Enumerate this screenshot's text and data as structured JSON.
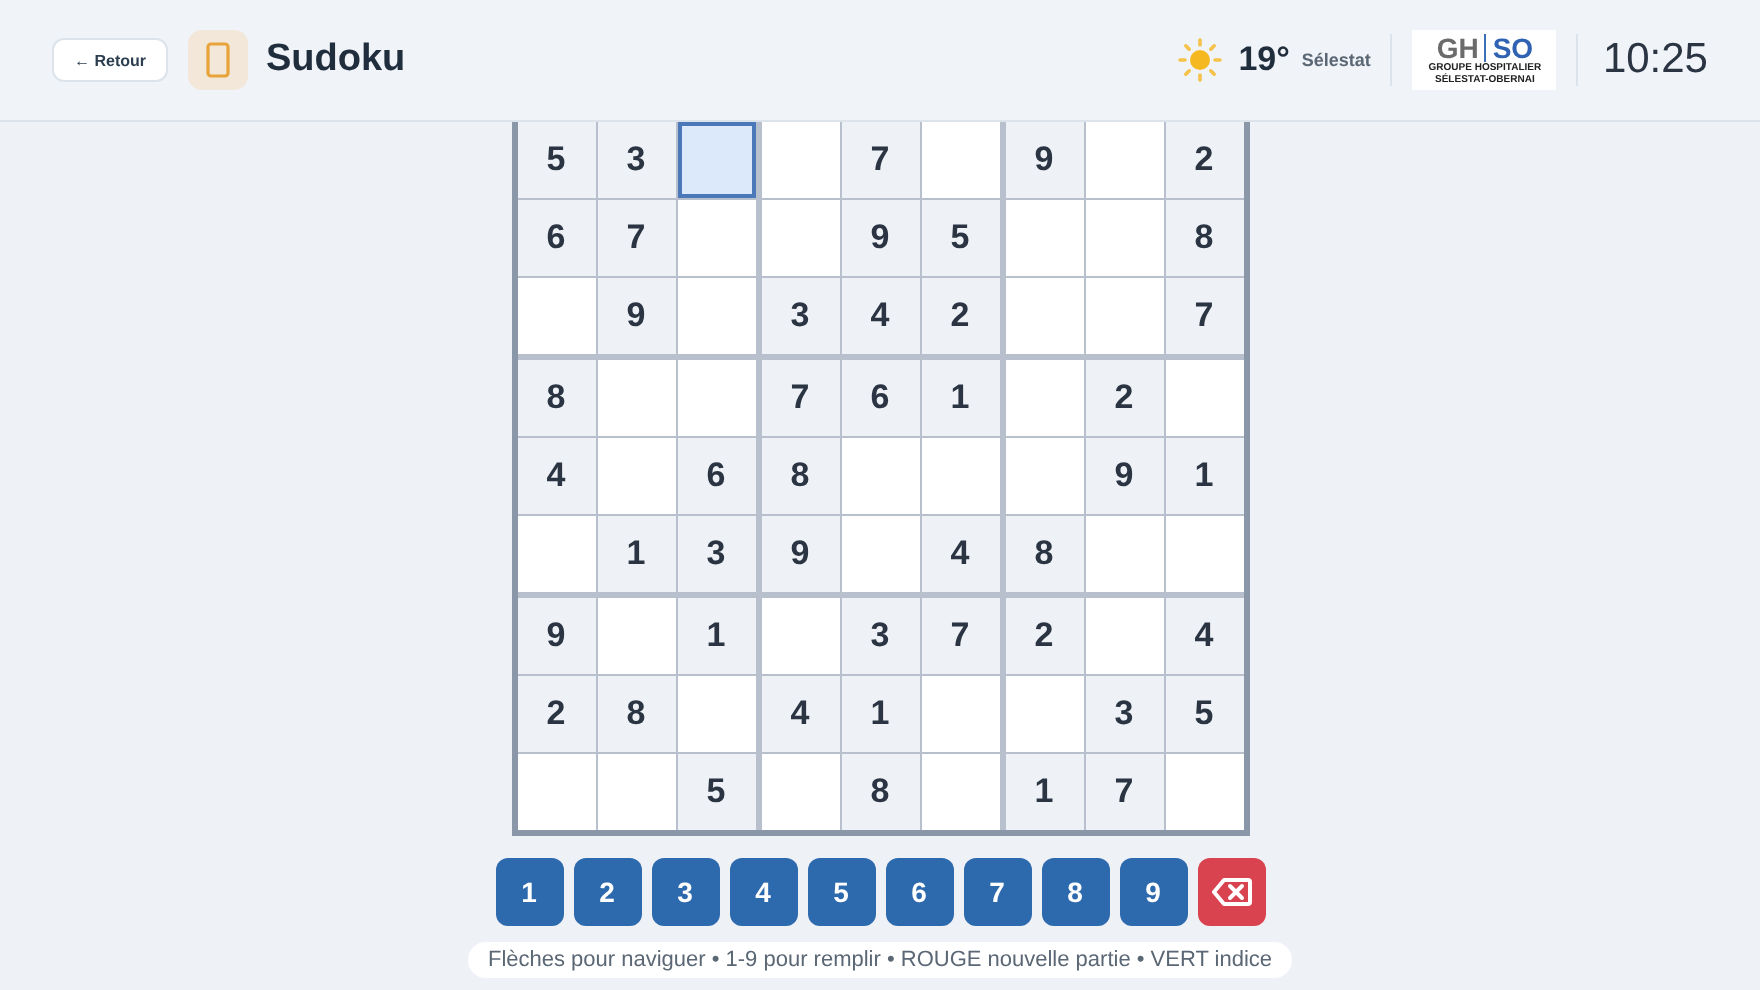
{
  "header": {
    "back_button": "← Retour",
    "title": "Sudoku",
    "weather": {
      "temperature": "19°",
      "city": "Sélestat"
    },
    "logo": {
      "top_left": "GH",
      "top_right": "SO",
      "line_1": "GROUPE HOSPITALIER",
      "line_2": "SÉLESTAT-OBERNAI"
    },
    "clock": "10:25"
  },
  "grid": [
    [
      {
        "value": "5",
        "selected": false
      },
      {
        "value": "3",
        "selected": false
      },
      {
        "selected": true
      },
      {
        "selected": false
      },
      {
        "value": "7",
        "selected": false
      },
      {
        "selected": false
      },
      {
        "value": "9",
        "selected": false
      },
      {
        "selected": false
      },
      {
        "value": "2",
        "selected": false
      }
    ],
    [
      {
        "value": "6",
        "selected": false
      },
      {
        "value": "7",
        "selected": false
      },
      {
        "selected": false
      },
      {
        "selected": false
      },
      {
        "value": "9",
        "selected": false
      },
      {
        "value": "5",
        "selected": false
      },
      {
        "selected": false
      },
      {
        "selected": false
      },
      {
        "value": "8",
        "selected": false
      }
    ],
    [
      {
        "selected": false
      },
      {
        "value": "9",
        "selected": false
      },
      {
        "selected": false
      },
      {
        "value": "3",
        "selected": false
      },
      {
        "value": "4",
        "selected": false
      },
      {
        "value": "2",
        "selected": false
      },
      {
        "selected": false
      },
      {
        "selected": false
      },
      {
        "value": "7",
        "selected": false
      }
    ],
    [
      {
        "value": "8",
        "selected": false
      },
      {
        "selected": false
      },
      {
        "selected": false
      },
      {
        "value": "7",
        "selected": false
      },
      {
        "value": "6",
        "selected": false
      },
      {
        "value": "1",
        "selected": false
      },
      {
        "selected": false
      },
      {
        "value": "2",
        "selected": false
      },
      {
        "selected": false
      }
    ],
    [
      {
        "value": "4",
        "selected": false
      },
      {
        "selected": false
      },
      {
        "value": "6",
        "selected": false
      },
      {
        "value": "8",
        "selected": false
      },
      {
        "selected": false
      },
      {
        "selected": false
      },
      {
        "selected": false
      },
      {
        "value": "9",
        "selected": false
      },
      {
        "value": "1",
        "selected": false
      }
    ],
    [
      {
        "selected": false
      },
      {
        "value": "1",
        "selected": false
      },
      {
        "value": "3",
        "selected": false
      },
      {
        "value": "9",
        "selected": false
      },
      {
        "selected": false
      },
      {
        "value": "4",
        "selected": false
      },
      {
        "value": "8",
        "selected": false
      },
      {
        "selected": false
      },
      {
        "selected": false
      }
    ],
    [
      {
        "value": "9",
        "selected": false
      },
      {
        "selected": false
      },
      {
        "value": "1",
        "selected": false
      },
      {
        "selected": false
      },
      {
        "value": "3",
        "selected": false
      },
      {
        "value": "7",
        "selected": false
      },
      {
        "value": "2",
        "selected": false
      },
      {
        "selected": false
      },
      {
        "value": "4",
        "selected": false
      }
    ],
    [
      {
        "value": "2",
        "selected": false
      },
      {
        "value": "8",
        "selected": false
      },
      {
        "selected": false
      },
      {
        "value": "4",
        "selected": false
      },
      {
        "value": "1",
        "selected": false
      },
      {
        "selected": false
      },
      {
        "selected": false
      },
      {
        "value": "3",
        "selected": false
      },
      {
        "value": "5",
        "selected": false
      }
    ],
    [
      {
        "selected": false
      },
      {
        "selected": false
      },
      {
        "value": "5",
        "selected": false
      },
      {
        "selected": false
      },
      {
        "value": "8",
        "selected": false
      },
      {
        "selected": false
      },
      {
        "value": "1",
        "selected": false
      },
      {
        "value": "7",
        "selected": false
      },
      {
        "selected": false
      }
    ]
  ],
  "keypad": [
    {
      "kind": "digit",
      "label": "1"
    },
    {
      "kind": "digit",
      "label": "2"
    },
    {
      "kind": "digit",
      "label": "3"
    },
    {
      "kind": "digit",
      "label": "4"
    },
    {
      "kind": "digit",
      "label": "5"
    },
    {
      "kind": "digit",
      "label": "6"
    },
    {
      "kind": "digit",
      "label": "7"
    },
    {
      "kind": "digit",
      "label": "8"
    },
    {
      "kind": "digit",
      "label": "9"
    },
    {
      "kind": "erase"
    }
  ],
  "hint": "Flèches pour naviguer • 1-9 pour remplir • ROUGE nouvelle partie • VERT indice"
}
